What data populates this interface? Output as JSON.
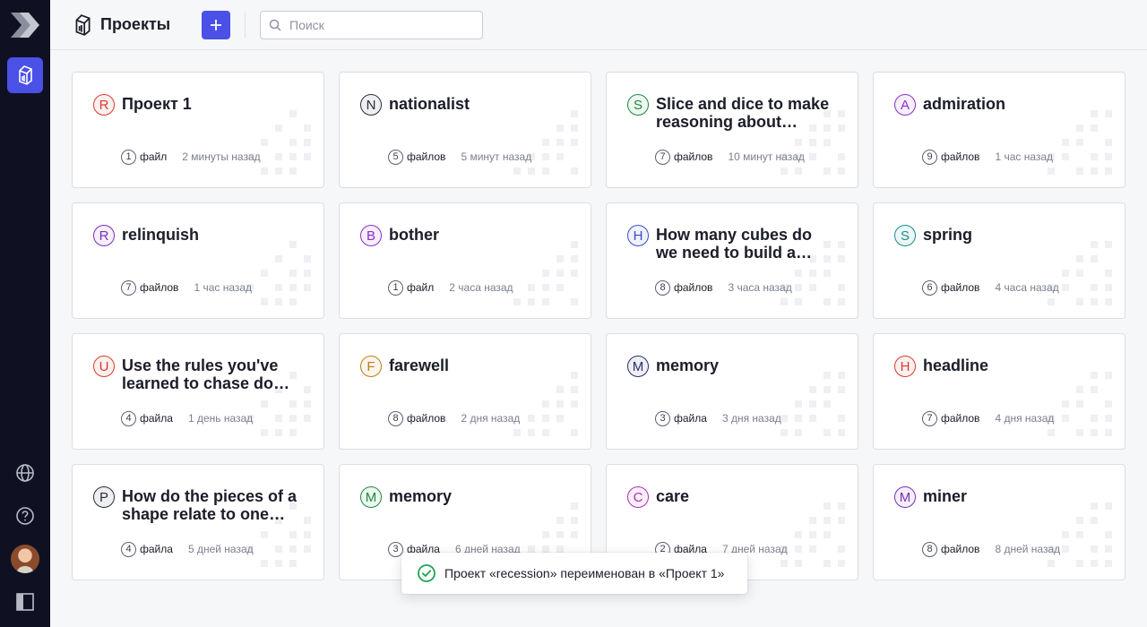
{
  "app": {
    "title": "Проекты",
    "colors": {
      "accent": "#4b50e6",
      "rail": "#0f1123",
      "success": "#1fa254"
    }
  },
  "header": {
    "title": "Проекты",
    "add_icon": "plus-icon",
    "search": {
      "placeholder": "Поиск",
      "value": ""
    }
  },
  "sidebar": {
    "items": [
      {
        "name": "projects",
        "icon": "projects-icon",
        "active": true
      },
      {
        "name": "language",
        "icon": "globe-icon"
      },
      {
        "name": "help",
        "icon": "help-icon"
      },
      {
        "name": "profile",
        "icon": "avatar"
      },
      {
        "name": "collapse",
        "icon": "sidebar-toggle-icon"
      }
    ]
  },
  "projects": [
    {
      "letter": "R",
      "color": "#d63b2f",
      "name": "Проект 1",
      "count": "1",
      "files": "файл",
      "time": "2 минуты назад"
    },
    {
      "letter": "N",
      "color": "#2a2d3a",
      "name": "nationalist",
      "count": "5",
      "files": "файлов",
      "time": "5 минут назад"
    },
    {
      "letter": "S",
      "color": "#1e8a3c",
      "name": "Slice and dice to make reasoning about shapes easier",
      "count": "7",
      "files": "файлов",
      "time": "10 минут назад"
    },
    {
      "letter": "A",
      "color": "#8a2fc9",
      "name": "admiration",
      "count": "9",
      "files": "файлов",
      "time": "1 час назад"
    },
    {
      "letter": "R",
      "color": "#7a2fb8",
      "name": "relinquish",
      "count": "7",
      "files": "файлов",
      "time": "1 час назад"
    },
    {
      "letter": "B",
      "color": "#8a2fc9",
      "name": "bother",
      "count": "1",
      "files": "файл",
      "time": "2 часа назад"
    },
    {
      "letter": "H",
      "color": "#3a4fc4",
      "name": "How many cubes do we need to build a cylinder",
      "count": "8",
      "files": "файлов",
      "time": "3 часа назад"
    },
    {
      "letter": "S",
      "color": "#1b8c8c",
      "name": "spring",
      "count": "6",
      "files": "файлов",
      "time": "4 часа назад"
    },
    {
      "letter": "U",
      "color": "#d63b2f",
      "name": "Use the rules you've learned to chase down answers",
      "count": "4",
      "files": "файла",
      "time": "1 день назад"
    },
    {
      "letter": "F",
      "color": "#c27b13",
      "name": "farewell",
      "count": "8",
      "files": "файлов",
      "time": "2 дня назад"
    },
    {
      "letter": "M",
      "color": "#2a2d6a",
      "name": "memory",
      "count": "3",
      "files": "файла",
      "time": "3 дня назад"
    },
    {
      "letter": "H",
      "color": "#d63b2f",
      "name": "headline",
      "count": "7",
      "files": "файлов",
      "time": "4 дня назад"
    },
    {
      "letter": "P",
      "color": "#2a2d3a",
      "name": "How do the pieces of a shape relate to one another",
      "count": "4",
      "files": "файла",
      "time": "5 дней назад"
    },
    {
      "letter": "M",
      "color": "#1e8a3c",
      "name": "memory",
      "count": "3",
      "files": "файла",
      "time": "6 дней назад"
    },
    {
      "letter": "C",
      "color": "#b02fb8",
      "name": "care",
      "count": "2",
      "files": "файла",
      "time": "7 дней назад"
    },
    {
      "letter": "M",
      "color": "#7a2fb8",
      "name": "miner",
      "count": "8",
      "files": "файлов",
      "time": "8 дней назад"
    }
  ],
  "toast": {
    "icon": "check-circle-icon",
    "message": "Проект «recession» переименован в «Проект 1»"
  }
}
